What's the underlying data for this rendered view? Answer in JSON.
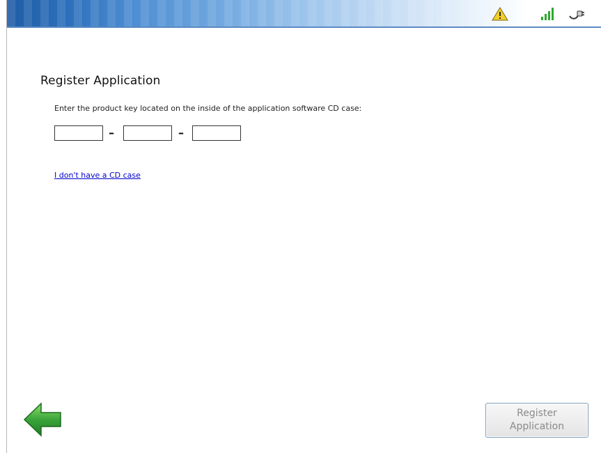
{
  "status_icons": {
    "warning": "warning-icon",
    "signal": "signal-strength-icon",
    "power": "power-plug-icon"
  },
  "colors": {
    "header_blue": "#1f5da6",
    "link": "#0000cc",
    "arrow_green": "#3aa53a"
  },
  "page": {
    "title": "Register Application",
    "instructions": "Enter the product key located on the inside of the application software CD case:",
    "key_separator": "–",
    "no_cd_link": "I don't have a CD case"
  },
  "footer": {
    "back_icon": "back-arrow-icon",
    "register_line1": "Register",
    "register_line2": "Application"
  }
}
